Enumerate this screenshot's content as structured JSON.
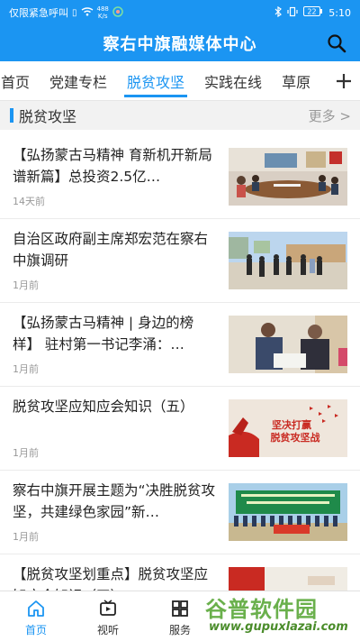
{
  "status_bar": {
    "carrier": "仅限紧急呼叫",
    "speed_top": "488",
    "speed_bottom": "K/s",
    "battery": "22",
    "time": "5:10"
  },
  "header": {
    "title": "察右中旗融媒体中心",
    "search_icon": "search-icon"
  },
  "tabs": [
    {
      "label": "首页"
    },
    {
      "label": "党建专栏"
    },
    {
      "label": "脱贫攻坚"
    },
    {
      "label": "实践在线"
    },
    {
      "label": "草原"
    }
  ],
  "tab_add_label": "+",
  "section": {
    "title": "脱贫攻坚",
    "more": "更多 >"
  },
  "news": [
    {
      "title": "【弘扬蒙古马精神 育新机开新局谱新篇】总投资2.5亿…",
      "time": "14天前"
    },
    {
      "title": "自治区政府副主席郑宏范在察右中旗调研",
      "time": "1月前"
    },
    {
      "title": "【弘扬蒙古马精神 | 身边的榜样】 驻村第一书记李涌：…",
      "time": "1月前"
    },
    {
      "title": "脱贫攻坚应知应会知识（五）",
      "time": "1月前"
    },
    {
      "title": "察右中旗开展主题为“决胜脱贫攻坚，共建绿色家园”新…",
      "time": "1月前"
    },
    {
      "title": "【脱贫攻坚划重点】脱贫攻坚应知应会知识（四）",
      "time": ""
    }
  ],
  "poster_text": {
    "line1": "坚决打赢",
    "line2": "脱贫攻坚战"
  },
  "tabbar": [
    {
      "label": "首页",
      "icon": "home-icon"
    },
    {
      "label": "视听",
      "icon": "video-icon"
    },
    {
      "label": "服务",
      "icon": "grid-icon"
    }
  ],
  "watermark": {
    "main": "谷普软件园",
    "url": "www.gupuxlazai.com"
  },
  "colors": {
    "accent": "#1b95f2",
    "header": "#1b95f2",
    "watermark": "#6ab04c"
  }
}
